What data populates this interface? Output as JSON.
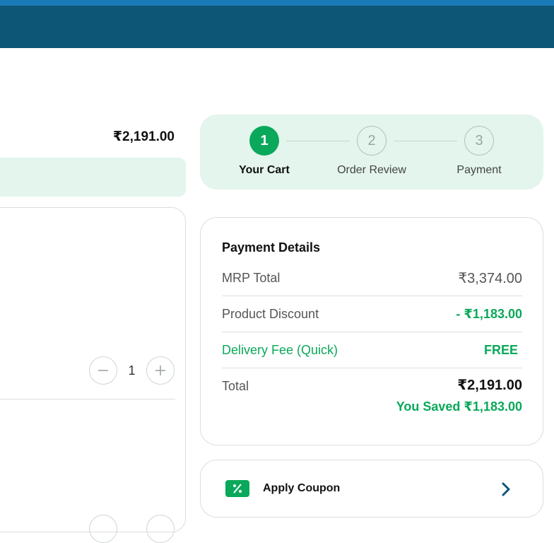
{
  "header": {
    "accent": "#0d5675",
    "strip": "#1a7ab8"
  },
  "cart": {
    "total": "₹2,191.00",
    "quantity": "1",
    "minus_icon": "minus-icon",
    "plus_icon": "plus-icon"
  },
  "stepper": {
    "steps": [
      {
        "number": "1",
        "label": "Your Cart",
        "state": "active"
      },
      {
        "number": "2",
        "label": "Order Review",
        "state": "inactive"
      },
      {
        "number": "3",
        "label": "Payment",
        "state": "inactive"
      }
    ]
  },
  "payment": {
    "title": "Payment Details",
    "rows": [
      {
        "label": "MRP Total",
        "value": "₹3,374.00"
      },
      {
        "label": "Product Discount",
        "value": "- ₹1,183.00"
      },
      {
        "label": "Delivery Fee (Quick)",
        "value": "FREE"
      }
    ],
    "total_label": "Total",
    "total_value": "₹2,191.00",
    "saved": "You Saved ₹1,183.00"
  },
  "coupon": {
    "label": "Apply Coupon",
    "icon": "percent-icon",
    "chevron": "chevron-right-icon"
  },
  "colors": {
    "green": "#0aa85a",
    "mint": "#e3f5ec"
  }
}
